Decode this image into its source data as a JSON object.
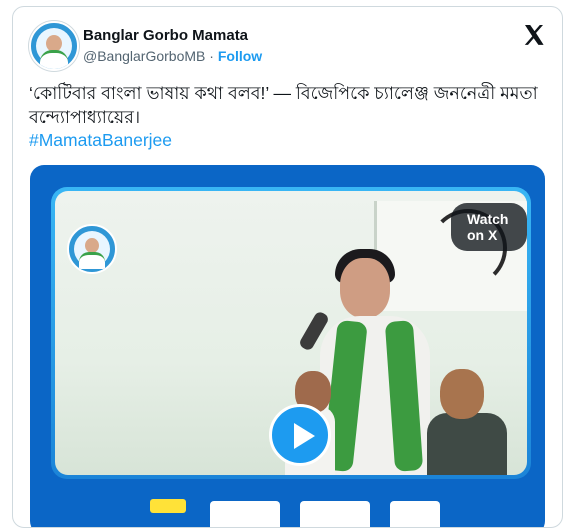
{
  "author": {
    "display_name": "Banglar Gorbo Mamata",
    "handle": "@BanglarGorboMB",
    "separator": "·",
    "follow_label": "Follow"
  },
  "tweet": {
    "text": "‘কোটিবার বাংলা ভাষায় কথা বলব!’ — বিজেপিকে চ্যালেঞ্জ জননেত্রী মমতা বন্দ্যোপাধ্যায়ের।",
    "hashtag": "#MamataBanerjee"
  },
  "media": {
    "watch_label": "Watch on X",
    "play_icon": "play-icon"
  },
  "icons": {
    "platform": "x-logo-icon"
  },
  "colors": {
    "accent": "#1d9bf0",
    "text": "#0f1419",
    "muted": "#536471",
    "media_frame": "#0b66c6"
  }
}
